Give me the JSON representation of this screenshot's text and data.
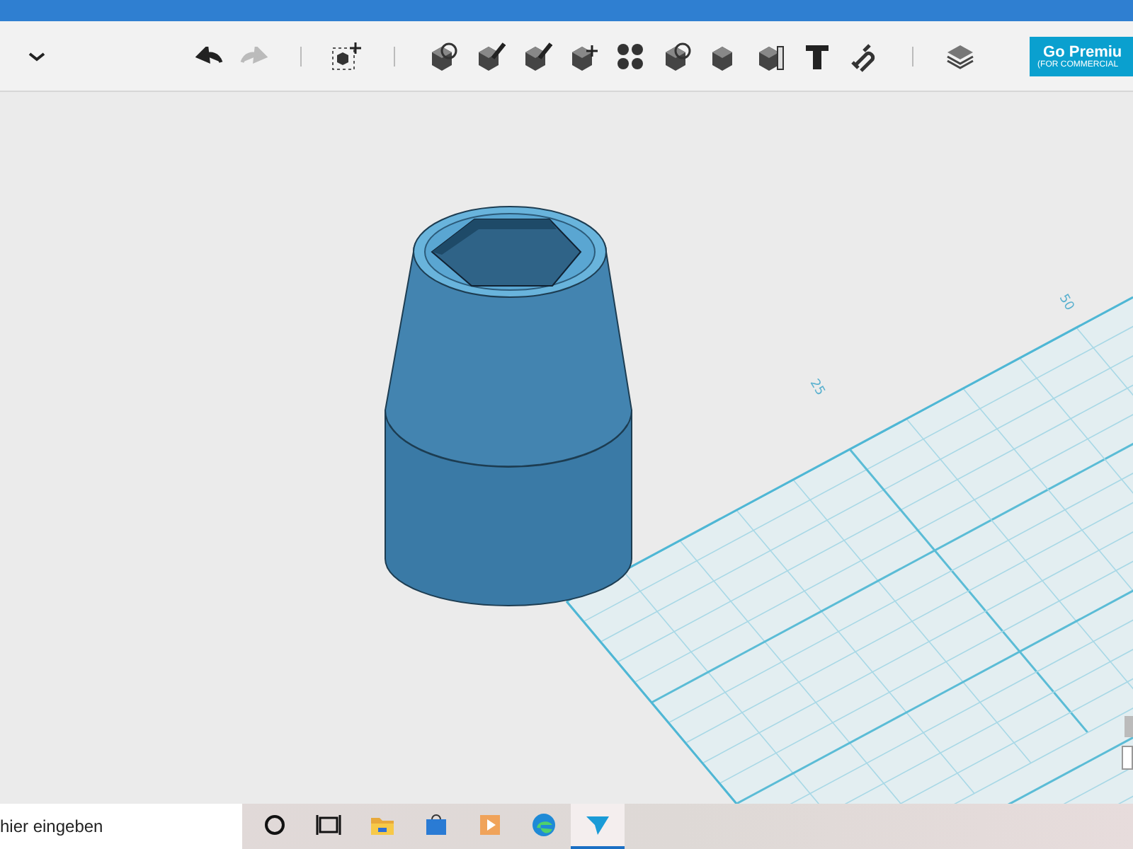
{
  "toolbar": {
    "undo": {
      "disabled": false
    },
    "redo": {
      "disabled": true
    }
  },
  "premium": {
    "title": "Go Premiu",
    "subtitle": "(FOR COMMERCIAL"
  },
  "grid_labels": [
    "25",
    "50"
  ],
  "taskbar": {
    "search": {
      "placeholder": "hier eingeben"
    },
    "apps": [
      {
        "kind": "cortana",
        "selected": false
      },
      {
        "kind": "taskview",
        "selected": false
      },
      {
        "kind": "folder",
        "selected": false
      },
      {
        "kind": "store",
        "selected": false
      },
      {
        "kind": "media",
        "selected": false
      },
      {
        "kind": "edge",
        "selected": false
      },
      {
        "kind": "arrow",
        "selected": true
      }
    ]
  }
}
